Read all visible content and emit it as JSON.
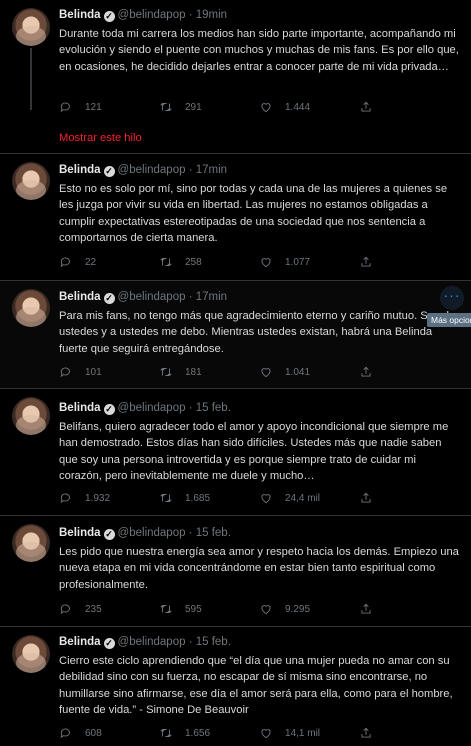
{
  "show_thread": "Mostrar este hilo",
  "more_tooltip": "Más opciones",
  "tweets": [
    {
      "name": "Belinda",
      "handle": "@belindapop",
      "time": "19min",
      "text": "Durante toda mi carrera los medios han sido parte importante, acompañando mi evolución y siendo el puente con muchos y muchas de mis fans. Es por ello que, en ocasiones, he decidido dejarles entrar a conocer parte de mi vida privada…",
      "replies": "121",
      "retweets": "291",
      "likes": "1.444"
    },
    {
      "name": "Belinda",
      "handle": "@belindapop",
      "time": "17min",
      "text": "Esto no es solo por mí, sino por todas y cada una de las mujeres a quienes se les juzga por vivir su vida en libertad. Las mujeres no estamos obligadas a cumplir expectativas estereotipadas de una sociedad que nos sentencia a comportarnos de cierta manera.",
      "replies": "22",
      "retweets": "258",
      "likes": "1.077"
    },
    {
      "name": "Belinda",
      "handle": "@belindapop",
      "time": "17min",
      "text": "Para mis fans, no tengo más que agradecimiento eterno y cariño mutuo. Soy de ustedes y a ustedes me debo. Mientras ustedes existan, habrá una Belinda fuerte que seguirá entregándose.",
      "replies": "101",
      "retweets": "181",
      "likes": "1.041"
    },
    {
      "name": "Belinda",
      "handle": "@belindapop",
      "time": "15 feb.",
      "text": "Belifans, quiero agradecer todo el amor y apoyo incondicional que siempre me han demostrado. Estos días han sido difíciles. Ustedes más que nadie saben que soy una persona introvertida y es porque siempre trato de cuidar mi corazón, pero inevitablemente me duele y mucho…",
      "replies": "1.932",
      "retweets": "1.685",
      "likes": "24,4 mil"
    },
    {
      "name": "Belinda",
      "handle": "@belindapop",
      "time": "15 feb.",
      "text": "Les pido que nuestra energía sea amor y respeto hacia los demás. Empiezo una nueva etapa en mi vida concentrándome en estar bien tanto espiritual como profesionalmente.",
      "replies": "235",
      "retweets": "595",
      "likes": "9.295"
    },
    {
      "name": "Belinda",
      "handle": "@belindapop",
      "time": "15 feb.",
      "text": "Cierro este ciclo aprendiendo que “el día que una mujer pueda no amar con su debilidad sino con su fuerza, no escapar de sí misma sino encontrarse, no humillarse sino afirmarse, ese día el amor será para ella, como para el hombre, fuente de vida.” - Simone De Beauvoir",
      "replies": "608",
      "retweets": "1.656",
      "likes": "14,1 mil"
    }
  ]
}
